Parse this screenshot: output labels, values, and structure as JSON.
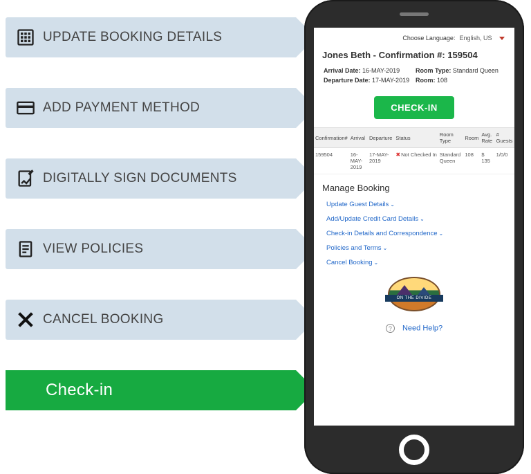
{
  "left_menu": {
    "items": [
      {
        "label": "UPDATE BOOKING DETAILS",
        "icon": "booking-details-icon"
      },
      {
        "label": "ADD PAYMENT METHOD",
        "icon": "payment-card-icon"
      },
      {
        "label": "DIGITALLY SIGN DOCUMENTS",
        "icon": "sign-document-icon"
      },
      {
        "label": "VIEW POLICIES",
        "icon": "policies-icon"
      },
      {
        "label": "CANCEL BOOKING",
        "icon": "cancel-x-icon"
      }
    ],
    "action": {
      "label": "Check-in"
    }
  },
  "screen": {
    "language": {
      "label": "Choose Language:",
      "selected": "English, US"
    },
    "title": "Jones Beth - Confirmation #: 159504",
    "info": {
      "arrival_label": "Arrival Date:",
      "arrival_value": "16-MAY-2019",
      "departure_label": "Departure Date:",
      "departure_value": "17-MAY-2019",
      "room_type_label": "Room Type:",
      "room_type_value": "Standard Queen",
      "room_label": "Room:",
      "room_value": "108"
    },
    "checkin_button": "CHECK-IN",
    "table": {
      "headers": [
        "Confirmation#",
        "Arrival",
        "Departure",
        "Status",
        "Room Type",
        "Room",
        "Avg. Rate",
        "# Guests"
      ],
      "row": {
        "confirmation": "159504",
        "arrival": "16-MAY-2019",
        "departure": "17-MAY-2019",
        "status": "Not Checked In",
        "room_type": "Standard Queen",
        "room": "108",
        "avg_rate": "$ 135",
        "guests": "1/0/0"
      }
    },
    "manage": {
      "heading": "Manage Booking",
      "links": [
        "Update Guest Details",
        "Add/Update Credit Card Details",
        "Check-in Details and Correspondence",
        "Policies and Terms",
        "Cancel Booking"
      ]
    },
    "logo_banner": "ON THE DIVIDE",
    "help_text": "Need Help?"
  }
}
